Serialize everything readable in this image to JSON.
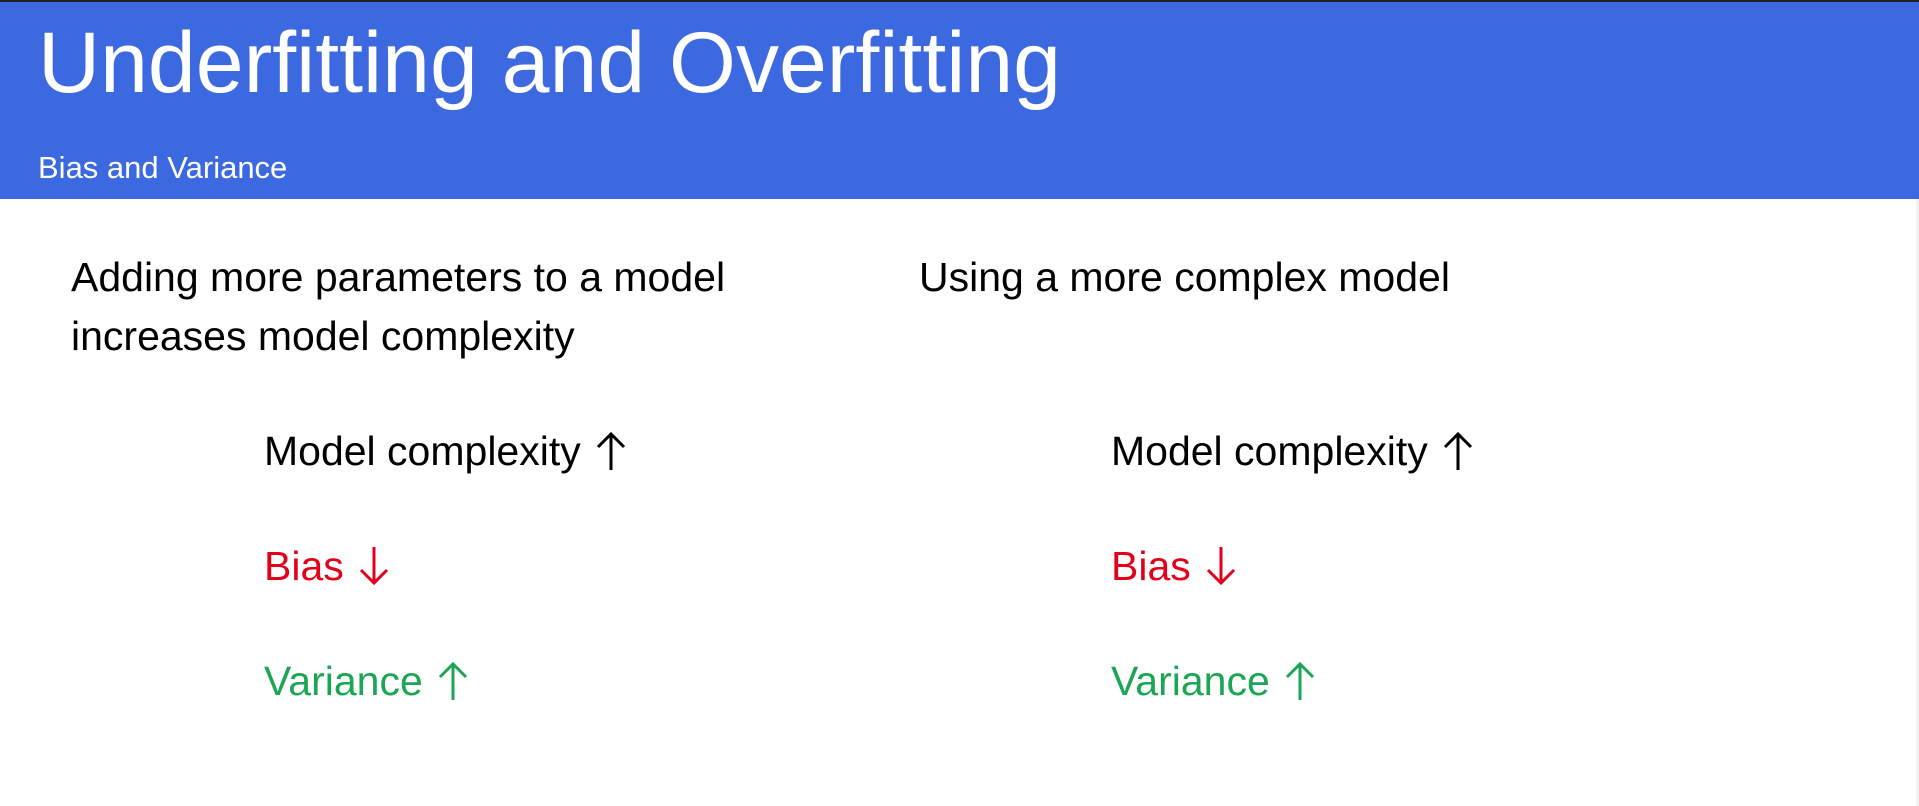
{
  "slide": {
    "title": "Underfitting and Overfitting",
    "subtitle": "Bias and Variance",
    "header_color": "#3c69e0"
  },
  "left_column": {
    "heading_lines": [
      "Adding more parameters to a model",
      "increases model complexity"
    ],
    "items": [
      {
        "label": "Model complexity",
        "direction": "up",
        "color": "#000000"
      },
      {
        "label": "Bias",
        "direction": "down",
        "color": "#e3001b"
      },
      {
        "label": "Variance",
        "direction": "up",
        "color": "#1aa653"
      }
    ]
  },
  "right_column": {
    "heading_lines": [
      "Using a more complex model"
    ],
    "items": [
      {
        "label": "Model complexity",
        "direction": "up",
        "color": "#000000"
      },
      {
        "label": "Bias",
        "direction": "down",
        "color": "#e3001b"
      },
      {
        "label": "Variance",
        "direction": "up",
        "color": "#1aa653"
      }
    ]
  }
}
